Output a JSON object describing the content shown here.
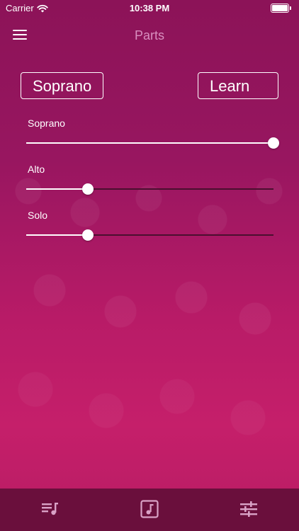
{
  "status_bar": {
    "carrier": "Carrier",
    "time": "10:38 PM",
    "wifi_icon": "wifi-icon",
    "battery_icon": "battery-icon"
  },
  "nav": {
    "title": "Parts",
    "menu_icon": "hamburger-menu-icon"
  },
  "controls": {
    "part_label": "Soprano",
    "mode_label": "Learn"
  },
  "sliders": [
    {
      "label": "Soprano",
      "value": 1.0
    },
    {
      "label": "Alto",
      "value": 0.25
    },
    {
      "label": "Solo",
      "value": 0.25
    }
  ],
  "tabs": [
    {
      "icon": "playlist-icon"
    },
    {
      "icon": "music-note-icon"
    },
    {
      "icon": "sliders-icon"
    }
  ],
  "colors": {
    "accent": "#c51f6a",
    "tab_bar": "#6a0f3c",
    "title": "#d88fbf"
  }
}
